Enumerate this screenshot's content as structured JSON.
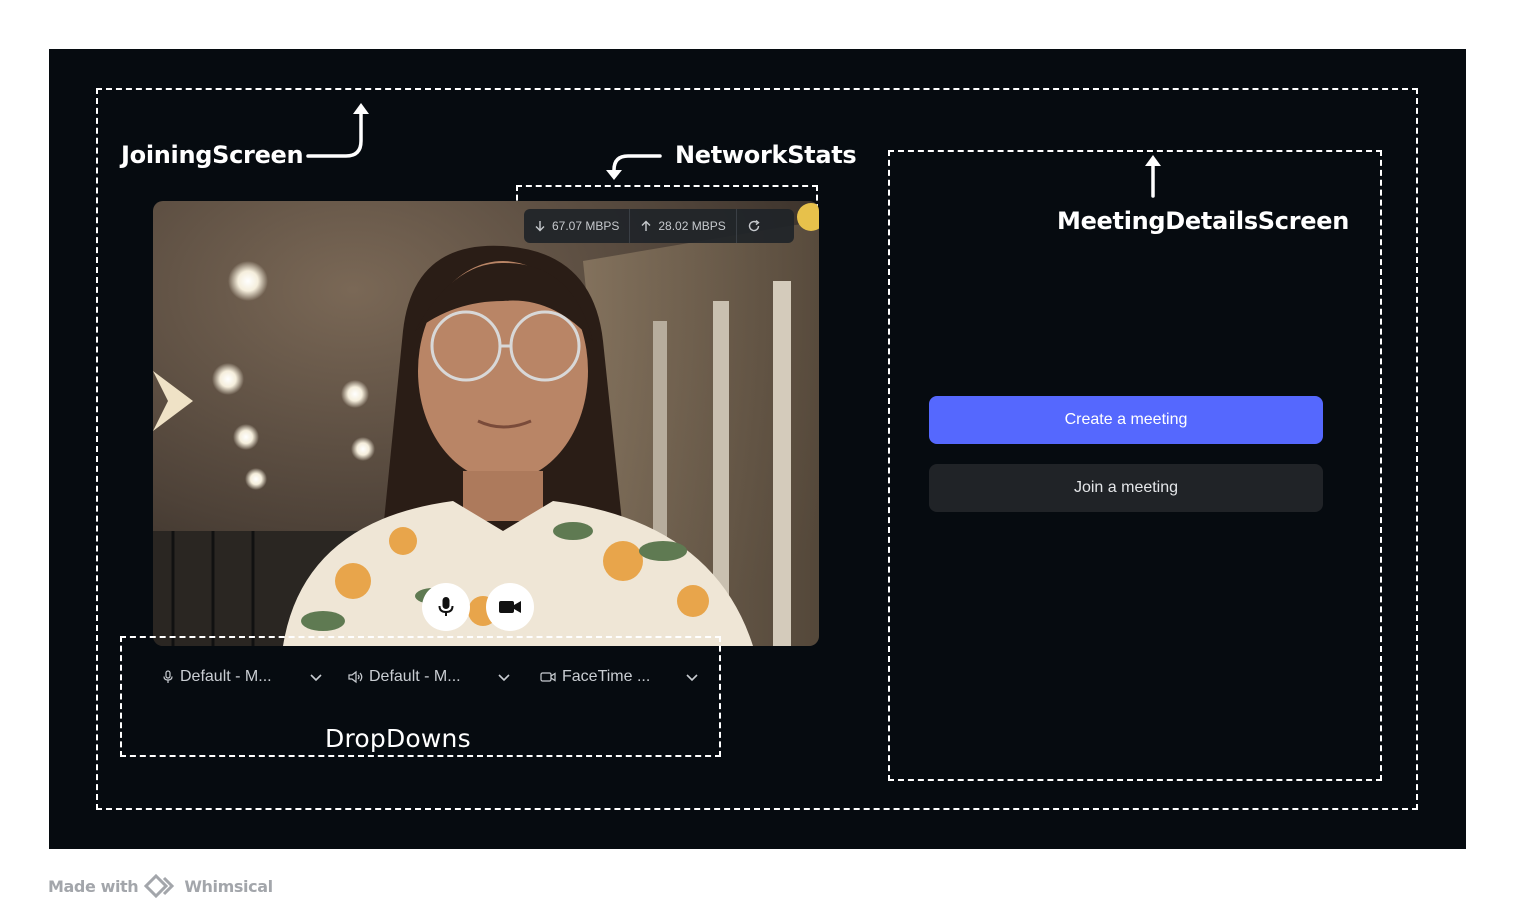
{
  "labels": {
    "joining_screen": "JoiningScreen",
    "network_stats": "NetworkStats",
    "meeting_details_screen": "MeetingDetailsScreen",
    "dropdowns": "DropDowns"
  },
  "network_stats": {
    "download": "67.07 MBPS",
    "upload": "28.02 MBPS",
    "download_icon": "arrow-down-icon",
    "upload_icon": "arrow-up-icon",
    "refresh_icon": "refresh-icon"
  },
  "controls": {
    "mic_icon": "microphone-icon",
    "camera_icon": "video-camera-icon"
  },
  "dropdowns": [
    {
      "icon": "microphone-icon",
      "value": "Default - M..."
    },
    {
      "icon": "speaker-icon",
      "value": "Default - M..."
    },
    {
      "icon": "video-camera-icon",
      "value": "FaceTime ..."
    }
  ],
  "meeting_details": {
    "create_label": "Create a meeting",
    "join_label": "Join a meeting"
  },
  "colors": {
    "background": "#060b10",
    "primary_button": "#5568fe",
    "secondary_button": "#202327"
  },
  "footer": {
    "made_with": "Made with",
    "brand": "Whimsical"
  }
}
